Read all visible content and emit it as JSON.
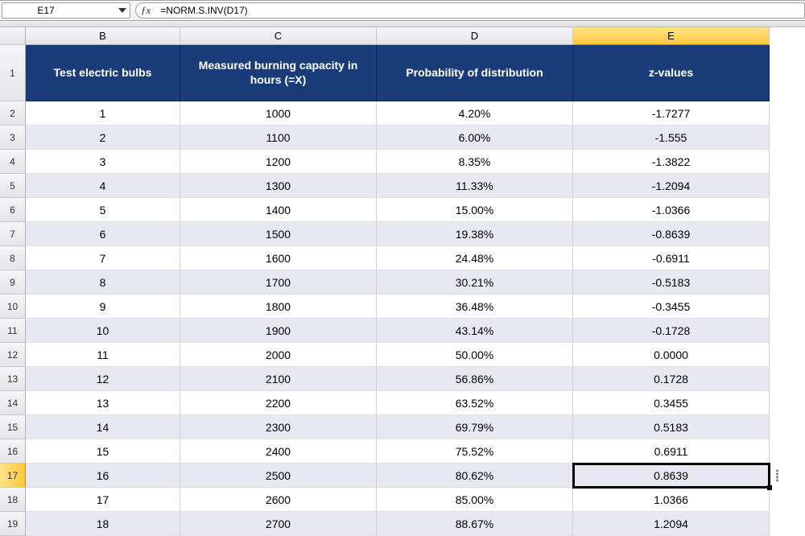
{
  "formula_bar": {
    "cell_ref": "E17",
    "formula": "=NORM.S.INV(D17)"
  },
  "columns": [
    "B",
    "C",
    "D",
    "E"
  ],
  "active_column": "E",
  "active_row": 17,
  "header_row": {
    "B": "Test electric bulbs",
    "C": "Measured burning capacity in hours (=X)",
    "D": "Probability of distribution",
    "E": "z-values"
  },
  "chart_data": {
    "type": "table",
    "title": "Test electric bulbs z-values",
    "columns": [
      "Test electric bulbs",
      "Measured burning capacity in hours (=X)",
      "Probability of distribution",
      "z-values"
    ],
    "rows": [
      [
        1,
        1000,
        "4.20%",
        -1.7277
      ],
      [
        2,
        1100,
        "6.00%",
        -1.555
      ],
      [
        3,
        1200,
        "8.35%",
        -1.3822
      ],
      [
        4,
        1300,
        "11.33%",
        -1.2094
      ],
      [
        5,
        1400,
        "15.00%",
        -1.0366
      ],
      [
        6,
        1500,
        "19.38%",
        -0.8639
      ],
      [
        7,
        1600,
        "24.48%",
        -0.6911
      ],
      [
        8,
        1700,
        "30.21%",
        -0.5183
      ],
      [
        9,
        1800,
        "36.48%",
        -0.3455
      ],
      [
        10,
        1900,
        "43.14%",
        -0.1728
      ],
      [
        11,
        2000,
        "50.00%",
        "0.0000"
      ],
      [
        12,
        2100,
        "56.86%",
        0.1728
      ],
      [
        13,
        2200,
        "63.52%",
        0.3455
      ],
      [
        14,
        2300,
        "69.79%",
        0.5183
      ],
      [
        15,
        2400,
        "75.52%",
        0.6911
      ],
      [
        16,
        2500,
        "80.62%",
        0.8639
      ],
      [
        17,
        2600,
        "85.00%",
        1.0366
      ],
      [
        18,
        2700,
        "88.67%",
        1.2094
      ]
    ]
  },
  "row_start": 2
}
